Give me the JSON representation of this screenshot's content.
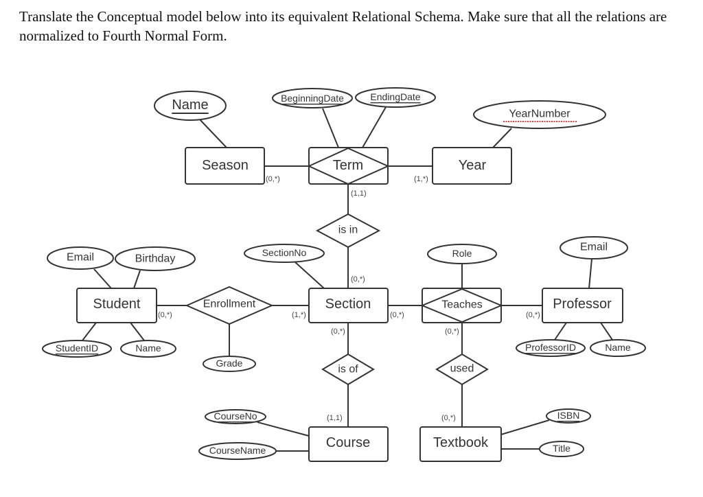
{
  "question": "Translate the Conceptual model below into its equivalent Relational Schema. Make sure that all the relations are normalized to Fourth Normal Form.",
  "entities": {
    "season": "Season",
    "term": "Term",
    "year": "Year",
    "student": "Student",
    "section": "Section",
    "teaches": "Teaches",
    "professor": "Professor",
    "course": "Course",
    "textbook": "Textbook"
  },
  "relationships": {
    "is_in": "is in",
    "enrollment": "Enrollment",
    "is_of": "is of",
    "used": "used"
  },
  "attributes": {
    "season_name": "Name",
    "beginning_date": "BeginningDate",
    "ending_date": "EndingDate",
    "year_number": "YearNumber",
    "student_email": "Email",
    "birthday": "Birthday",
    "section_no": "SectionNo",
    "role": "Role",
    "professor_email": "Email",
    "student_id": "StudentID",
    "student_name": "Name",
    "grade": "Grade",
    "professor_id": "ProfessorID",
    "professor_name": "Name",
    "course_no": "CourseNo",
    "course_name": "CourseName",
    "isbn": "ISBN",
    "title": "Title"
  },
  "cardinalities": {
    "season_term": "(0,*)",
    "year_term": "(1,*)",
    "term_isin": "(1,1)",
    "section_isin": "(0,*)",
    "student_enrollment": "(0,*)",
    "section_enrollment": "(1,*)",
    "section_teaches": "(0,*)",
    "section_isof": "(0,*)",
    "teaches_used": "(0,*)",
    "professor_teaches": "(0,*)",
    "course_isof": "(1,1)",
    "textbook_used": "(0,*)"
  }
}
